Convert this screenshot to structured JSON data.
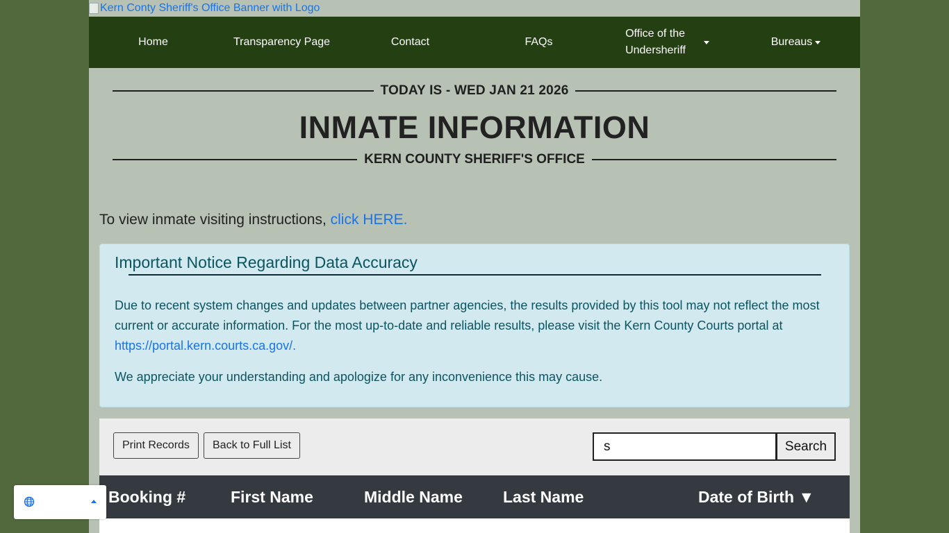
{
  "banner": {
    "alt_text": "Kern Conty Sheriff's Office Banner with Logo"
  },
  "nav": {
    "items": [
      {
        "label": "Home"
      },
      {
        "label": "Transparency Page"
      },
      {
        "label": "Contact"
      },
      {
        "label": "FAQs"
      },
      {
        "label_line1": "Office of the",
        "label_line2": "Undersheriff"
      },
      {
        "label": "Bureaus"
      }
    ]
  },
  "header": {
    "today": "TODAY IS - WED JAN 21 2026",
    "title": "INMATE INFORMATION",
    "office": "KERN COUNTY SHERIFF'S OFFICE"
  },
  "visiting": {
    "text": "To view inmate visiting instructions, ",
    "link": "click HERE."
  },
  "notice": {
    "heading": "Important Notice Regarding Data Accuracy",
    "para1": "Due to recent system changes and updates between partner agencies, the results provided by this tool may not reflect the most current or accurate information. For the most up-to-date and reliable results, please visit the Kern County Courts portal at ",
    "para1_link": "https://portal.kern.courts.ca.gov/.",
    "para2": "We appreciate your understanding and apologize for any inconvenience this may cause."
  },
  "toolbar": {
    "print_label": "Print Records",
    "back_label": "Back to Full List",
    "search_value": "s",
    "search_label": "Search"
  },
  "table": {
    "columns": [
      "Booking #",
      "First Name",
      "Middle Name",
      "Last Name",
      "Date of Birth ▼"
    ]
  },
  "colors": {
    "background": "#52683d",
    "nav": "#243f12",
    "page": "#b8c2b4",
    "notice_bg": "#d1e9ef",
    "table_header": "#343a40",
    "link": "#1a73e8"
  }
}
